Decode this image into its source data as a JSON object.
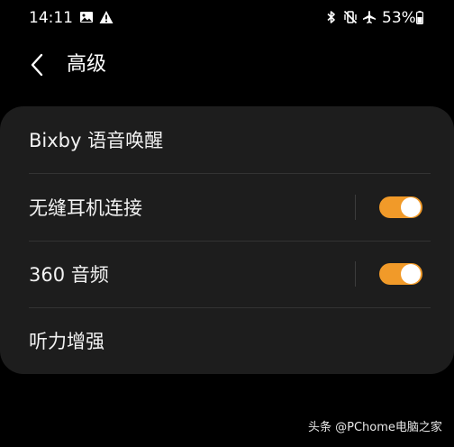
{
  "status_bar": {
    "time": "14:11",
    "battery": "53%",
    "icons": [
      "image-icon",
      "alert-icon",
      "bluetooth-icon",
      "vibrate-off-icon",
      "airplane-mode-icon",
      "battery-icon"
    ]
  },
  "header": {
    "title": "高级",
    "back_icon": "chevron-left-icon"
  },
  "settings": [
    {
      "label": "Bixby 语音唤醒",
      "has_toggle": false
    },
    {
      "label": "无缝耳机连接",
      "has_toggle": true,
      "enabled": true
    },
    {
      "label": "360 音频",
      "has_toggle": true,
      "enabled": true
    },
    {
      "label": "听力增强",
      "has_toggle": false
    }
  ],
  "colors": {
    "background": "#000000",
    "card": "#1d1d1d",
    "toggle_on": "#f19a29",
    "text": "#ffffff"
  },
  "watermark": "头条 @PChome电脑之家"
}
